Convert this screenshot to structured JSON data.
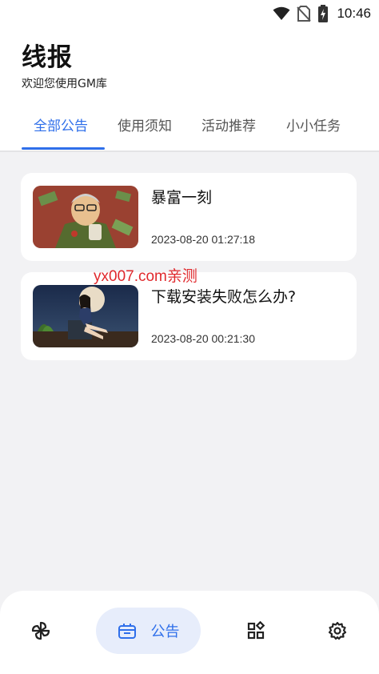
{
  "status_bar": {
    "time": "10:46",
    "icons": [
      "wifi-icon",
      "no-sim-icon",
      "battery-charging-icon"
    ]
  },
  "header": {
    "title": "线报",
    "subtitle": "欢迎您使用GM库"
  },
  "tabs": [
    {
      "label": "全部公告",
      "active": true
    },
    {
      "label": "使用须知",
      "active": false
    },
    {
      "label": "活动推荐",
      "active": false
    },
    {
      "label": "小小任务",
      "active": false
    }
  ],
  "announcements": [
    {
      "title": "暴富一刻",
      "time": "2023-08-20 01:27:18",
      "thumb": "cartoon-man-with-money-image"
    },
    {
      "title": "下载安装失败怎么办?",
      "time": "2023-08-20 00:21:30",
      "thumb": "woman-under-full-moon-image"
    }
  ],
  "watermark": "yx007.com亲测",
  "bottom_nav": {
    "items": [
      {
        "icon": "pinwheel-icon",
        "label": "",
        "active": false
      },
      {
        "icon": "bulletin-icon",
        "label": "公告",
        "active": true
      },
      {
        "icon": "apps-grid-icon",
        "label": "",
        "active": false
      },
      {
        "icon": "settings-gear-icon",
        "label": "",
        "active": false
      }
    ]
  },
  "colors": {
    "accent": "#2f6fea",
    "active_nav_bg": "#e7edfb",
    "background": "#f2f2f4",
    "watermark": "#e0282c"
  }
}
